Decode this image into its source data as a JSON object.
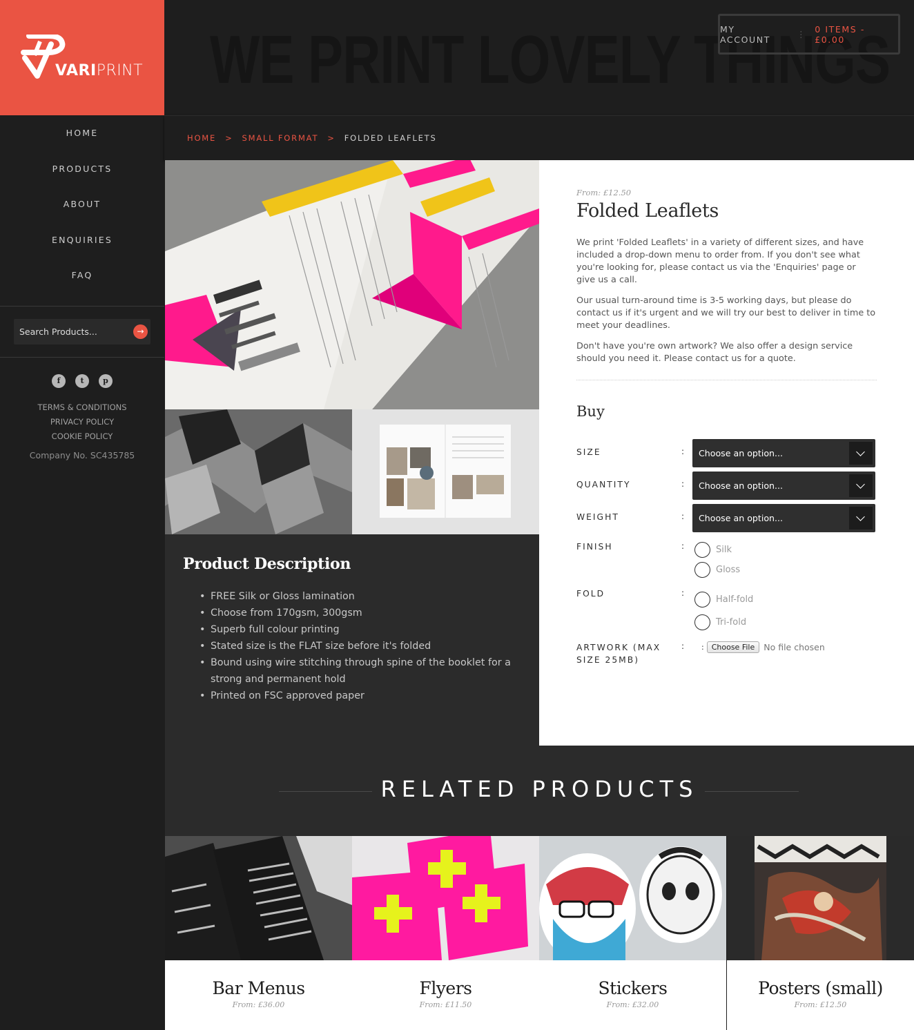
{
  "brand": {
    "name_bold": "VARI",
    "name_light": "PRINT",
    "accent": "#ea5443"
  },
  "header": {
    "tagline": "WE PRINT LOVELY THINGS",
    "my_account": "MY ACCOUNT",
    "separator": "⋮",
    "cart": "0 ITEMS - £0.00"
  },
  "sidebar": {
    "nav": [
      "HOME",
      "PRODUCTS",
      "ABOUT",
      "ENQUIRIES",
      "FAQ"
    ],
    "search_placeholder": "Search Products...",
    "social": [
      "f",
      "t",
      "p"
    ],
    "links": [
      "TERMS & CONDITIONS",
      "PRIVACY POLICY",
      "COOKIE POLICY"
    ],
    "company": "Company No. SC435785"
  },
  "breadcrumb": {
    "home": "HOME",
    "category": "SMALL FORMAT",
    "current": "FOLDED LEAFLETS",
    "sep": ">"
  },
  "product": {
    "from": "From: £12.50",
    "title": "Folded Leaflets",
    "paragraphs": [
      "We print 'Folded Leaflets' in a variety of different sizes, and have included a drop-down menu to order from. If you don't see what you're looking for, please contact us via the 'Enquiries' page or give us a call.",
      "Our usual turn-around time is 3-5 working days, but please do contact us if it's urgent and we will try our best to deliver in time to meet your deadlines.",
      "Don't have you're own artwork? We also offer a design service should you need it. Please contact us for a quote."
    ],
    "buy_heading": "Buy",
    "colon": ":",
    "options": {
      "size": {
        "label": "SIZE",
        "value": "Choose an option..."
      },
      "quantity": {
        "label": "QUANTITY",
        "value": "Choose an option..."
      },
      "weight": {
        "label": "WEIGHT",
        "value": "Choose an option..."
      },
      "finish": {
        "label": "FINISH",
        "choices": [
          "Silk",
          "Gloss"
        ]
      },
      "fold": {
        "label": "FOLD",
        "choices": [
          "Half-fold",
          "Tri-fold"
        ]
      },
      "artwork": {
        "label": "ARTWORK (MAX SIZE 25MB)",
        "button": "Choose File",
        "status": "No file chosen"
      }
    }
  },
  "description": {
    "heading": "Product Description",
    "items": [
      "FREE Silk or Gloss lamination",
      "Choose from 170gsm, 300gsm",
      "Superb full colour printing",
      "Stated size is the FLAT size before it's folded",
      "Bound using wire stitching through spine of the booklet for a strong and permanent hold",
      "Printed on FSC approved paper"
    ]
  },
  "related": {
    "heading": "RELATED PRODUCTS",
    "items": [
      {
        "name": "Bar Menus",
        "price": "From: £36.00"
      },
      {
        "name": "Flyers",
        "price": "From: £11.50"
      },
      {
        "name": "Stickers",
        "price": "From: £32.00"
      },
      {
        "name": "Posters (small)",
        "price": "From: £12.50"
      }
    ]
  }
}
